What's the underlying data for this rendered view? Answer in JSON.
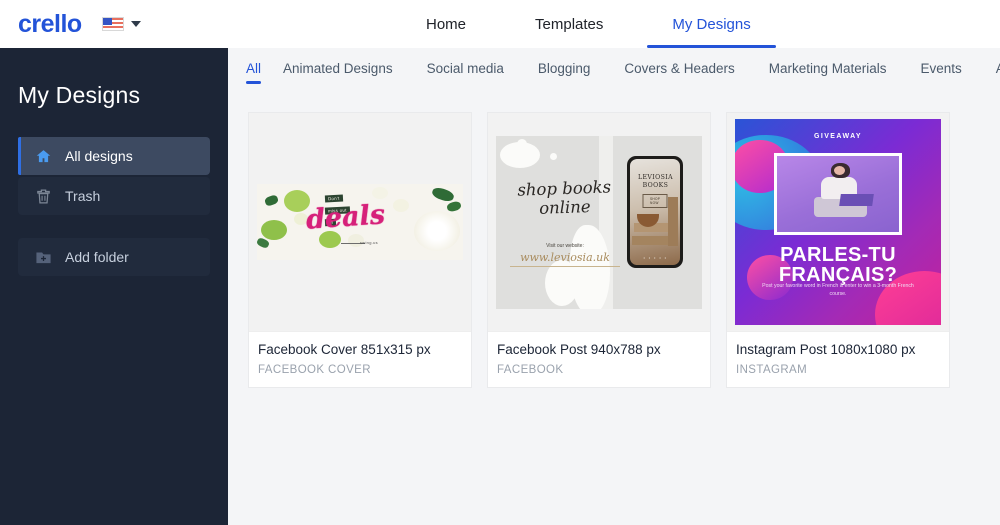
{
  "header": {
    "logo_text": "crello",
    "language": {
      "flag": "us-flag-icon",
      "caret": "chevron-down-icon"
    },
    "nav": [
      {
        "label": "Home",
        "active": false
      },
      {
        "label": "Templates",
        "active": false
      },
      {
        "label": "My Designs",
        "active": true
      }
    ]
  },
  "sidebar": {
    "title": "My Designs",
    "items": [
      {
        "label": "All designs",
        "icon": "home-icon",
        "active": true
      },
      {
        "label": "Trash",
        "icon": "trash-icon",
        "active": false
      },
      {
        "label": "Add folder",
        "icon": "folder-add-icon",
        "active": false
      }
    ]
  },
  "main": {
    "category_tabs": [
      {
        "label": "All",
        "active": true
      },
      {
        "label": "Animated Designs",
        "active": false
      },
      {
        "label": "Social media",
        "active": false
      },
      {
        "label": "Blogging",
        "active": false
      },
      {
        "label": "Covers & Headers",
        "active": false
      },
      {
        "label": "Marketing Materials",
        "active": false
      },
      {
        "label": "Events",
        "active": false
      },
      {
        "label": "Ac",
        "active": false
      }
    ],
    "cards": [
      {
        "title": "Facebook Cover 851x315 px",
        "subtitle": "FACEBOOK COVER",
        "art": {
          "headline": "deals",
          "tag_line1": "Don't",
          "tag_line2": "miss out",
          "tag_line3": "on",
          "caption": "swing.us"
        }
      },
      {
        "title": "Facebook Post 940x788 px",
        "subtitle": "FACEBOOK",
        "art": {
          "headline": "shop books\nonline",
          "visit_label": "Visit our website:",
          "url": "www.leviosia.uk",
          "phone_brand": "LEVIOSIA\nBOOKS",
          "phone_button": "SHOP NOW",
          "phone_dots": "• • • • •"
        }
      },
      {
        "title": "Instagram Post 1080x1080 px",
        "subtitle": "INSTAGRAM",
        "art": {
          "kicker": "GIVEAWAY",
          "headline_line1": "PARLES-TU",
          "headline_line2": "FRANÇAIS?",
          "subtext": "Post your favorite word in French & enter to win a 3-month French course."
        }
      }
    ]
  },
  "colors": {
    "brand_blue": "#2353d8",
    "sidebar_bg": "#1c2536",
    "sidebar_active_bg": "#3d4a61",
    "active_bar": "#2f6fe4",
    "main_bg": "#f4f5f7",
    "card_bg": "#ffffff"
  }
}
